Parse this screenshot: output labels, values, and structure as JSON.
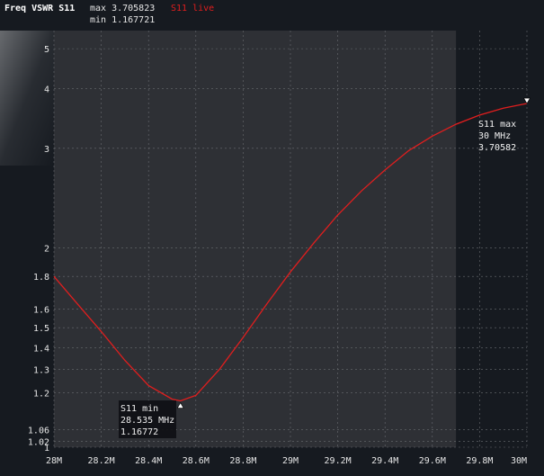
{
  "header": {
    "title": "Freq VSWR S11",
    "max_text": "max 3.705823",
    "min_text": "min 1.167721",
    "live_text": "S11 live"
  },
  "colors": {
    "background": "#161a20",
    "band_fill": "#2e3035",
    "trace": "#e01e1e",
    "grid": "#6a6d72",
    "live_label": "#e01e1e"
  },
  "markers": {
    "min": {
      "line1": "S11 min",
      "line2": "28.535 MHz",
      "line3": "1.16772"
    },
    "max": {
      "line1": "S11 max",
      "line2": "30 MHz",
      "line3": "3.70582"
    }
  },
  "chart_data": {
    "type": "line",
    "xlim": [
      28.0,
      30.0
    ],
    "ylim": [
      1,
      5.6
    ],
    "y_scale": "vswr",
    "grid": true,
    "highlight_band": [
      28.0,
      29.7
    ],
    "x_tick_values": [
      28.0,
      28.2,
      28.4,
      28.6,
      28.8,
      29.0,
      29.2,
      29.4,
      29.6,
      29.8,
      30.0
    ],
    "x_tick_labels": [
      "28M",
      "28.2M",
      "28.4M",
      "28.6M",
      "28.8M",
      "29M",
      "29.2M",
      "29.4M",
      "29.6M",
      "29.8M",
      "30M"
    ],
    "y_tick_values": [
      1,
      1.02,
      1.06,
      1.2,
      1.3,
      1.4,
      1.5,
      1.6,
      1.8,
      2,
      3,
      4,
      5
    ],
    "y_tick_labels": [
      "1",
      "1.02",
      "1.06",
      "1.2",
      "1.3",
      "1.4",
      "1.5",
      "1.6",
      "1.8",
      "2",
      "3",
      "4",
      "5"
    ],
    "series": [
      {
        "name": "S11 live",
        "x": [
          28.0,
          28.1,
          28.2,
          28.3,
          28.4,
          28.5,
          28.535,
          28.6,
          28.7,
          28.8,
          28.9,
          29.0,
          29.1,
          29.2,
          29.3,
          29.4,
          29.5,
          29.6,
          29.7,
          29.8,
          29.9,
          30.0
        ],
        "y": [
          1.8,
          1.63,
          1.48,
          1.34,
          1.23,
          1.175,
          1.168,
          1.19,
          1.3,
          1.45,
          1.63,
          1.83,
          2.04,
          2.27,
          2.5,
          2.73,
          2.97,
          3.17,
          3.35,
          3.5,
          3.62,
          3.706
        ]
      }
    ],
    "marker_points": [
      {
        "x": 28.535,
        "y": 1.16772
      },
      {
        "x": 30.0,
        "y": 3.70582
      }
    ]
  }
}
